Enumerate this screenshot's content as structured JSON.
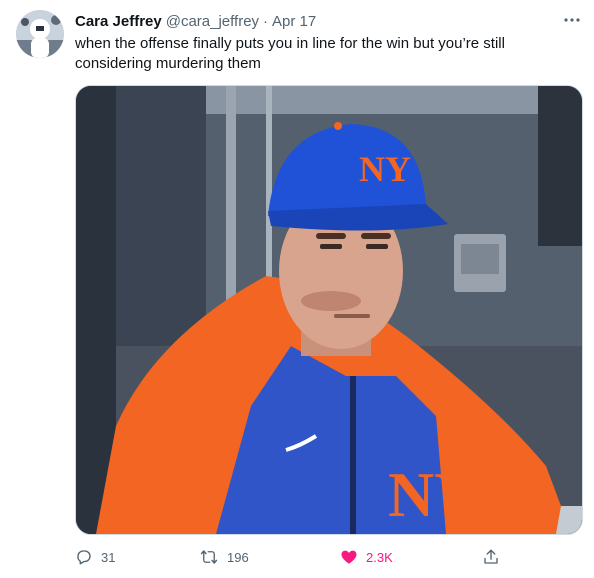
{
  "tweet": {
    "author_name": "Cara Jeffrey",
    "handle": "@cara_jeffrey",
    "separator": "·",
    "date": "Apr 17",
    "text": "when the offense finally puts you in line for the win but you’re still considering murdering them",
    "more_icon": "more-horizontal-icon",
    "media": {
      "description_icon": "photo",
      "cap_logo": "NY"
    },
    "actions": {
      "reply": {
        "icon": "reply-icon",
        "count": "31"
      },
      "retweet": {
        "icon": "retweet-icon",
        "count": "196"
      },
      "like": {
        "icon": "heart-filled-icon",
        "count": "2.3K",
        "color": "#f91880"
      },
      "share": {
        "icon": "share-icon"
      }
    },
    "colors": {
      "text": "#0f1419",
      "secondary": "#536471",
      "like": "#f91880",
      "border": "#cfd9de"
    }
  }
}
